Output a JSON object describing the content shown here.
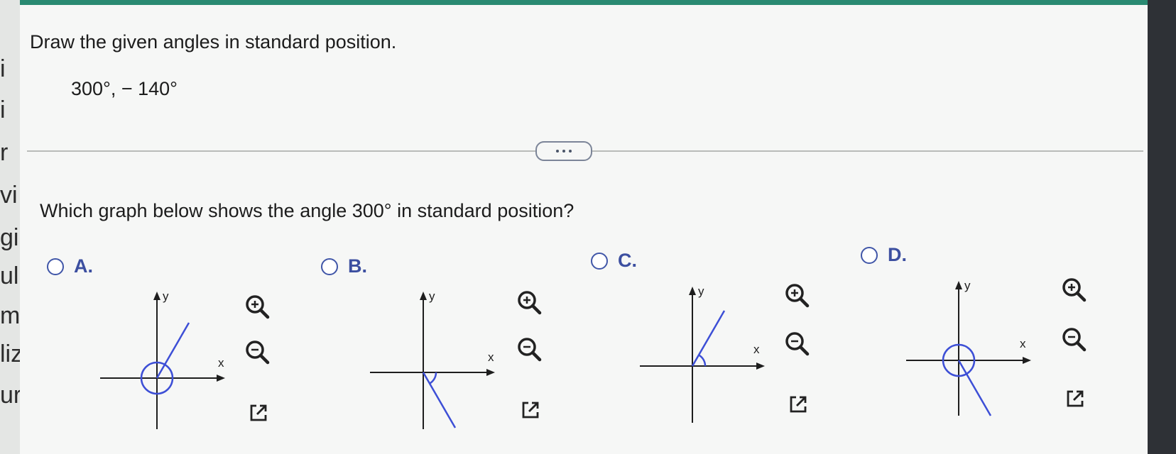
{
  "side_fragments": [
    "i",
    "i",
    "r",
    "vi",
    "gi",
    "ul",
    "ml",
    "liz",
    "ur"
  ],
  "question": {
    "prompt": "Draw the given angles in standard position.",
    "angles": "300°,  − 140°",
    "more_button": "more-options",
    "part_question": "Which graph below shows the angle 300° in standard position?"
  },
  "options": [
    {
      "label": "A.",
      "angle_deg": 60
    },
    {
      "label": "B.",
      "angle_deg": -60
    },
    {
      "label": "C.",
      "angle_deg": 60
    },
    {
      "label": "D.",
      "angle_deg": -60
    }
  ],
  "axis_labels": {
    "x": "x",
    "y": "y"
  },
  "tools": [
    "zoom-in-icon",
    "zoom-out-icon",
    "open-external-icon"
  ],
  "colors": {
    "accent": "#2a8a72",
    "radio": "#4056a8",
    "ray": "#3d4fd6",
    "axis": "#1e1e1e"
  }
}
